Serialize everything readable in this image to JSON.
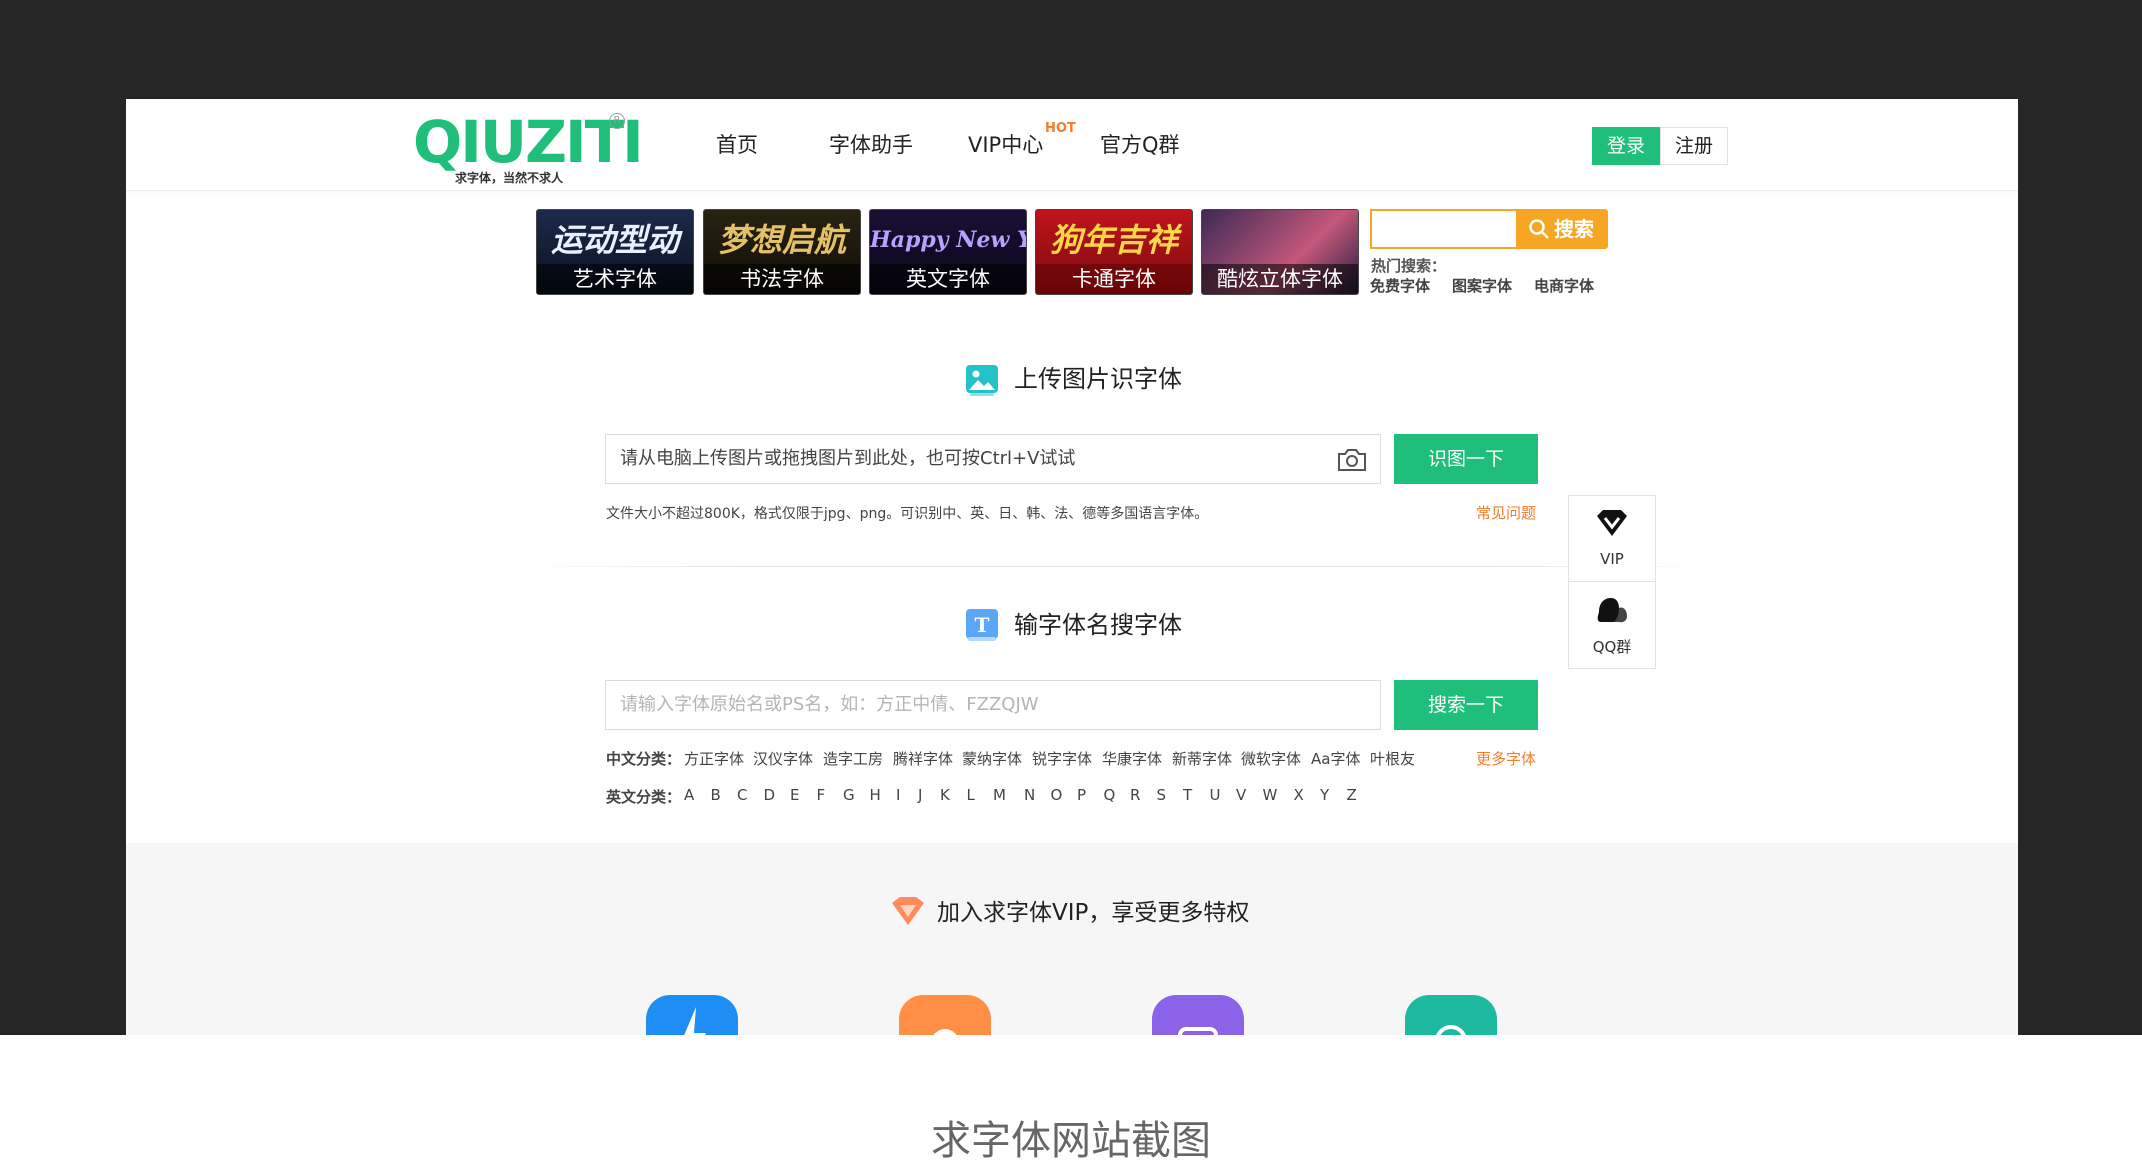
{
  "header": {
    "logo_text": "QIUZITI",
    "logo_reg": "R",
    "logo_tagline": "求字体，当然不求人",
    "nav": [
      "首页",
      "字体助手",
      "VIP中心",
      "官方Q群"
    ],
    "hot_badge": "HOT",
    "login_label": "登录",
    "register_label": "注册"
  },
  "banners": [
    {
      "art": "运动型动",
      "caption": "艺术字体"
    },
    {
      "art": "梦想启航",
      "caption": "书法字体"
    },
    {
      "art": "Happy New Year",
      "caption": "英文字体"
    },
    {
      "art": "狗年吉祥",
      "caption": "卡通字体"
    },
    {
      "art": "",
      "caption": "酷炫立体字体"
    }
  ],
  "mini_search": {
    "button_label": "搜索",
    "hot_label": "热门搜索：",
    "hot_links": [
      "免费字体",
      "图案字体",
      "电商字体"
    ]
  },
  "upload": {
    "title": "上传图片识字体",
    "placeholder": "请从电脑上传图片或拖拽图片到此处，也可按Ctrl+V试试",
    "button_label": "识图一下",
    "hint": "文件大小不超过800K，格式仅限于jpg、png。可识别中、英、日、韩、法、德等多国语言字体。",
    "faq_link": "常见问题"
  },
  "name_search": {
    "title": "输字体名搜字体",
    "placeholder": "请输入字体原始名或PS名，如：方正中倩、FZZQJW",
    "button_label": "搜索一下",
    "chinese_label": "中文分类：",
    "chinese_categories": [
      "方正字体",
      "汉仪字体",
      "造字工房",
      "腾祥字体",
      "蒙纳字体",
      "锐字字体",
      "华康字体",
      "新蒂字体",
      "微软字体",
      "Aa字体",
      "叶根友"
    ],
    "more_link": "更多字体",
    "english_label": "英文分类：",
    "letters": [
      "A",
      "B",
      "C",
      "D",
      "E",
      "F",
      "G",
      "H",
      "I",
      "J",
      "K",
      "L",
      "M",
      "N",
      "O",
      "P",
      "Q",
      "R",
      "S",
      "T",
      "U",
      "V",
      "W",
      "X",
      "Y",
      "Z"
    ]
  },
  "side_panel": {
    "vip_label": "VIP",
    "qq_label": "QQ群"
  },
  "vip_section": {
    "title": "加入求字体VIP，享受更多特权"
  },
  "colors": {
    "brand_green": "#1fbf7b",
    "orange": "#f57c2a",
    "search_orange": "#f7a623"
  },
  "caption": "求字体网站截图"
}
